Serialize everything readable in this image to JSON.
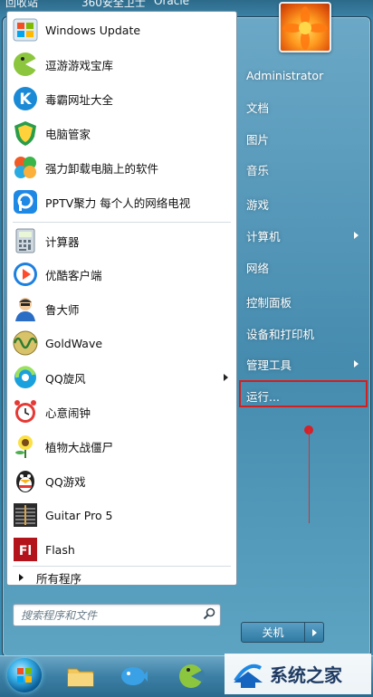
{
  "top_strip": {
    "items": [
      "回收站",
      "360安全卫士",
      "Oracle"
    ]
  },
  "start_menu": {
    "left_programs": [
      {
        "label": "Windows Update",
        "icon": "windows-update-icon"
      },
      {
        "label": "逗游游戏宝库",
        "icon": "douyou-game-icon"
      },
      {
        "label": "毒霸网址大全",
        "icon": "duba-web-icon"
      },
      {
        "label": "电脑管家",
        "icon": "pc-manager-icon"
      },
      {
        "label": "强力卸载电脑上的软件",
        "icon": "uninstaller-icon"
      },
      {
        "label": "PPTV聚力 每个人的网络电视",
        "icon": "pptv-icon"
      }
    ],
    "recent_programs": [
      {
        "label": "计算器",
        "icon": "calculator-icon"
      },
      {
        "label": "优酷客户端",
        "icon": "youku-icon"
      },
      {
        "label": "鲁大师",
        "icon": "ludashi-icon"
      },
      {
        "label": "GoldWave",
        "icon": "goldwave-icon"
      },
      {
        "label": "QQ旋风",
        "icon": "qq-xuanfeng-icon",
        "has_submenu": true
      },
      {
        "label": "心意闹钟",
        "icon": "alarm-clock-icon"
      },
      {
        "label": "植物大战僵尸",
        "icon": "pvz-icon"
      },
      {
        "label": "QQ游戏",
        "icon": "qq-game-icon"
      },
      {
        "label": "Guitar Pro 5",
        "icon": "guitar-pro-icon"
      },
      {
        "label": "Flash",
        "icon": "flash-icon"
      }
    ],
    "all_programs_label": "所有程序",
    "search_placeholder": "搜索程序和文件",
    "right_items": [
      {
        "label": "Administrator"
      },
      {
        "label": "文档"
      },
      {
        "label": "图片"
      },
      {
        "label": "音乐"
      },
      {
        "label": "游戏"
      },
      {
        "label": "计算机",
        "has_submenu": true
      },
      {
        "label": "网络"
      },
      {
        "label": "控制面板"
      },
      {
        "label": "设备和打印机"
      },
      {
        "label": "管理工具",
        "has_submenu": true
      },
      {
        "label": "运行...",
        "highlighted": true
      }
    ],
    "shutdown_label": "关机"
  },
  "taskbar": {
    "icons": [
      "start-orb-icon",
      "folder-icon",
      "fish-app-icon",
      "game-app-icon"
    ]
  },
  "watermark": {
    "text": "系统之家"
  },
  "colors": {
    "highlight_red": "#d21f1f",
    "menu_blue": "#3b83a8"
  }
}
